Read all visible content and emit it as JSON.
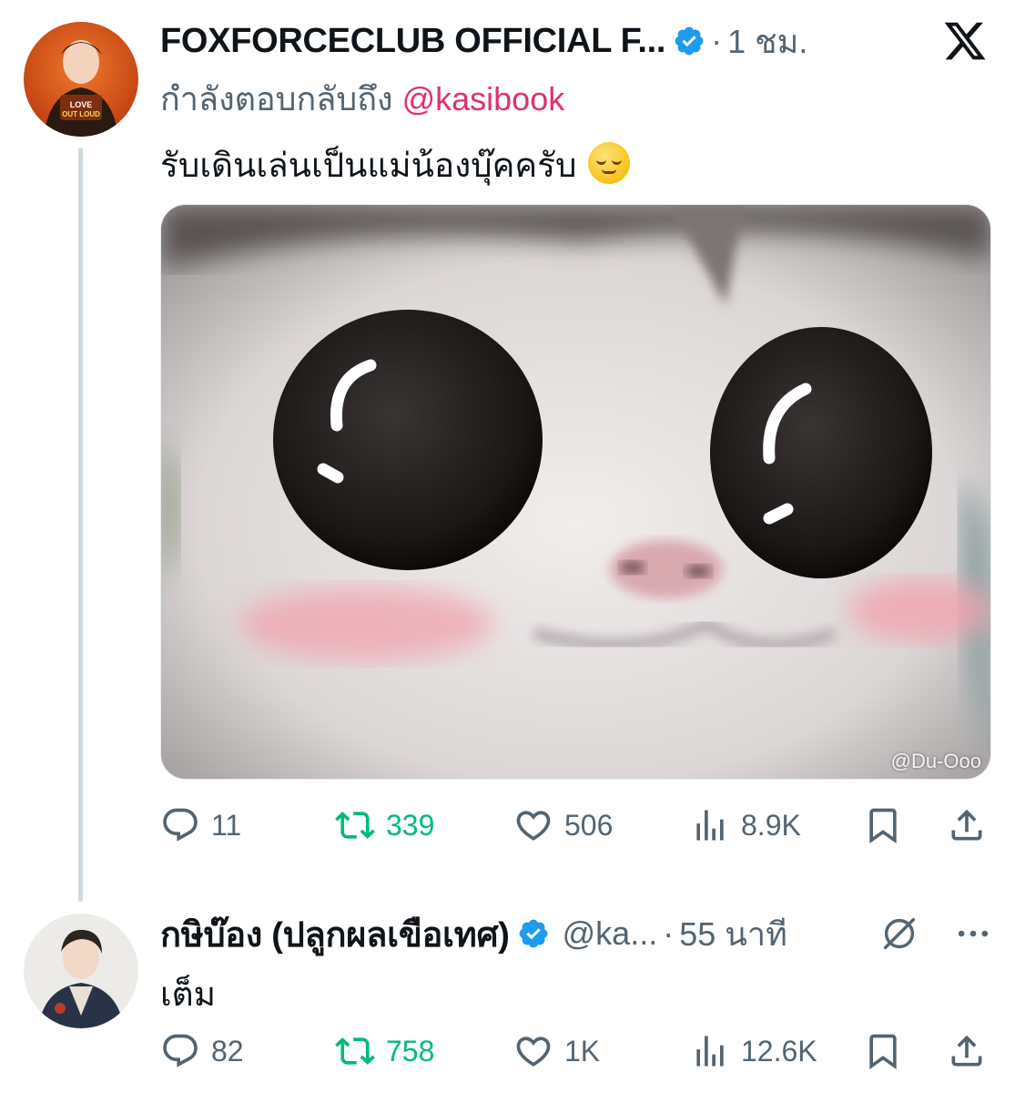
{
  "tweet1": {
    "display_name": "FOXFORCECLUB OFFICIAL F...",
    "time": "1 ชม.",
    "reply_to_prefix": "กำลังตอบกลับถึง ",
    "reply_to_handle": "@kasibook",
    "text": "รับเดินเล่นเป็นแม่น้องบุ๊คครับ",
    "emoji": "relieved-face-emoji",
    "media_watermark": "@Du-Ooo",
    "stats": {
      "replies": "11",
      "retweets": "339",
      "likes": "506",
      "views": "8.9K"
    }
  },
  "tweet2": {
    "display_name": "กษิบ๊อง (ปลูกผลเขือเทศ)",
    "handle": "@ka...",
    "time": "55 นาที",
    "text": "เต็ม",
    "stats": {
      "replies": "82",
      "retweets": "758",
      "likes": "1K",
      "views": "12.6K"
    }
  },
  "separator": "·",
  "colors": {
    "accent_mention": "#e0306f",
    "verified_blue": "#1d9bf0",
    "retweet_green": "#00ba7c",
    "muted_text": "#536471",
    "thread_line": "#cfd9de"
  },
  "icons": [
    "reply-icon",
    "retweet-icon",
    "like-icon",
    "views-icon",
    "bookmark-icon",
    "share-icon",
    "verified-icon",
    "x-logo-icon",
    "grok-icon",
    "more-icon"
  ]
}
